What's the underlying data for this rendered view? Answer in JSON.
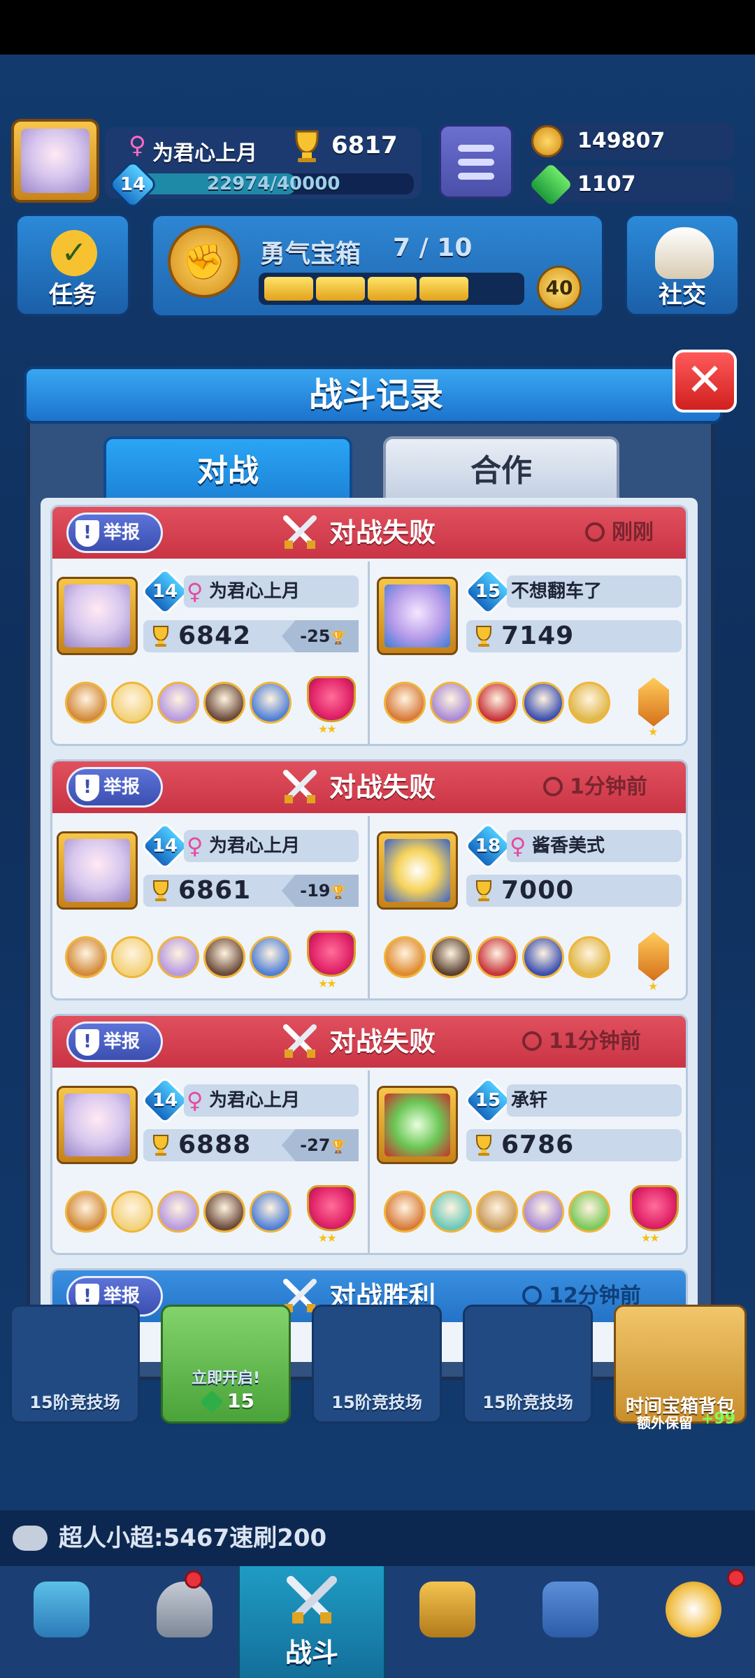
{
  "hud": {
    "player_name": "为君心上月",
    "trophies": "6817",
    "level": "14",
    "xp": "22974/40000",
    "xp_fraction": 0.574,
    "coins": "149807",
    "gems": "1107"
  },
  "side": {
    "tasks_label": "任务",
    "social_label": "社交",
    "chest_title": "勇气宝箱",
    "chest_progress": "7 / 10",
    "chest_cost": "40",
    "chest_fill_fraction": 0.7
  },
  "modal": {
    "title": "战斗记录",
    "close_symbol": "✕",
    "tabs": [
      {
        "label": "对战",
        "active": true
      },
      {
        "label": "合作",
        "active": false
      }
    ]
  },
  "records": [
    {
      "result": "对战失败",
      "outcome": "lose",
      "time": "刚刚",
      "report_label": "举报",
      "self": {
        "level": "14",
        "name": "为君心上月",
        "female": true,
        "trophies": "6842",
        "delta": "-25"
      },
      "opponent": {
        "level": "15",
        "name": "不想翻车了",
        "female": false,
        "trophies": "7149"
      }
    },
    {
      "result": "对战失败",
      "outcome": "lose",
      "time": "1分钟前",
      "report_label": "举报",
      "self": {
        "level": "14",
        "name": "为君心上月",
        "female": true,
        "trophies": "6861",
        "delta": "-19"
      },
      "opponent": {
        "level": "18",
        "name": "酱香美式",
        "female": true,
        "trophies": "7000"
      }
    },
    {
      "result": "对战失败",
      "outcome": "lose",
      "time": "11分钟前",
      "report_label": "举报",
      "self": {
        "level": "14",
        "name": "为君心上月",
        "female": true,
        "trophies": "6888",
        "delta": "-27"
      },
      "opponent": {
        "level": "15",
        "name": "承轩",
        "female": false,
        "trophies": "6786"
      }
    },
    {
      "result": "对战胜利",
      "outcome": "win",
      "time": "12分钟前",
      "report_label": "举报"
    }
  ],
  "bottom_chests": [
    {
      "label": "15阶竞技场"
    },
    {
      "label": "立即开启!",
      "cost": "15"
    },
    {
      "label": "15阶竞技场"
    },
    {
      "label": "15阶竞技场"
    }
  ],
  "time_chest": {
    "title": "时间宝箱背包",
    "subtitle": "额外保留",
    "bonus": "+99"
  },
  "chat": {
    "text": "超人小超:5467速刷200"
  },
  "nav": {
    "active_label": "战斗"
  },
  "colors": {
    "lose_header": "#d9414f",
    "win_header": "#2f82d6",
    "tab_active": "#1f8ee0"
  }
}
